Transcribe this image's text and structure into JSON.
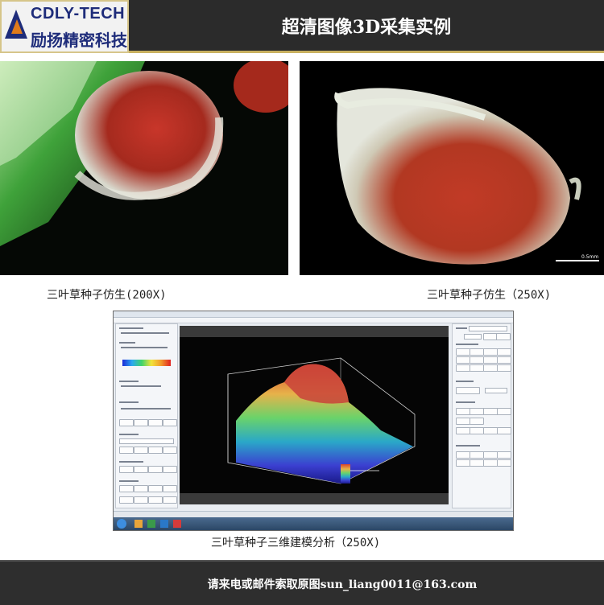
{
  "header": {
    "logo_en": "CDLY-TECH",
    "logo_cn": "励扬精密科技",
    "title": "超清图像3D采集实例"
  },
  "photos": [
    {
      "caption": "三叶草种子仿生(200X)"
    },
    {
      "caption": "三叶草种子仿生（250X)",
      "scale_label": "0.5mm"
    }
  ],
  "software": {
    "caption": "三叶草种子三维建模分析（250X)"
  },
  "footer": {
    "contact": "请来电或邮件索取原图sun_liang0011@163.com"
  },
  "colors": {
    "header_bg": "#2b2b2b",
    "accent_gold": "#c8b060",
    "logo_blue": "#1e2c7a",
    "logo_orange": "#e07b1b"
  }
}
